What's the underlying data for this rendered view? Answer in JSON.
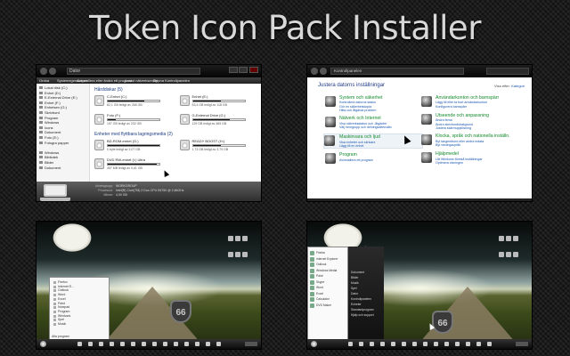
{
  "title": "Token Icon Pack Installer",
  "explorer": {
    "address": "Dator",
    "toolbar": [
      "Ordna",
      "Systemegenskaper",
      "Avinstallera eller ändra ett program",
      "Anslut nätverksenhet",
      "Öppna Kontrollpanelen"
    ],
    "sidebar": [
      "Lokal disk (C:)",
      "Enhet (D:)",
      "E-External Drive (E:)",
      "Enhet (F:)",
      "Enhetsen (G:)",
      "Skrivbord",
      "Program",
      "Windows",
      "Icons",
      "Dokument",
      "Foto (E:)",
      "Fotogra papper",
      "",
      "Windows",
      "Bibliotek",
      "Bilder",
      "Dokument"
    ],
    "group_hdd": "Hårddiskar (5)",
    "group_removable": "Enheter med flyttbara lagringsmedia (2)",
    "drives": [
      {
        "name": "C-Enhet (C:)",
        "free": "82,1 GB ledigt av 265 GB",
        "used": 0.7
      },
      {
        "name": "Enhet (E:)",
        "free": "53,4 GB ledigt av 118 GB",
        "used": 0.55
      },
      {
        "name": "Foto (F:)",
        "free": "197 GB ledigt av 232 GB",
        "used": 0.15
      },
      {
        "name": "G-External Drive (G:)",
        "free": "129 GB ledigt av 465 GB",
        "used": 0.72
      },
      {
        "name": "BD-ROM-enhet (G:)",
        "free": "0 byte ledigt av 2,07 GB",
        "used": 1.0
      },
      {
        "name": "READY BOOST (H:)",
        "free": "1,73 GB ledigt av 3,79 GB",
        "used": 0.55
      },
      {
        "name": "DVD RW-enhet (I:) Ultra",
        "free": "457 MB ledigt av 9,61 GB",
        "used": 0.95
      }
    ],
    "details": [
      {
        "label": "Arbetsgrupp:",
        "value": "WORKGROUP"
      },
      {
        "label": "Processor:",
        "value": "Intel(R) Core(TM) 2 Duo CPU E6750 @ 2,66GHz"
      },
      {
        "label": "Minne:",
        "value": "4,00 GB"
      }
    ]
  },
  "controlpanel": {
    "address": "Kontrollpanelen",
    "heading": "Justera datorns inställningar",
    "view_by": "Visa efter:",
    "view_value": "Kategori",
    "left_categories": [
      {
        "name": "System och säkerhet",
        "links": [
          "Kontrollera datorns status",
          "Gör en säkerhetskopia",
          "Hitta och åtgärda problem"
        ]
      },
      {
        "name": "Nätverk och Internet",
        "links": [
          "Visa nätverksstatus och -åtgärder",
          "Välj hemgrupp och delningsalternativ"
        ]
      },
      {
        "name": "Maskinvara och ljud",
        "links": [
          "Visa enheter och skrivare",
          "Lägg till en enhet"
        ]
      },
      {
        "name": "Program",
        "links": [
          "Avinstallera ett program"
        ]
      }
    ],
    "right_categories": [
      {
        "name": "Användarkonton och barnspärr",
        "links": [
          "Lägg till eller ta bort användarkonton",
          "Konfigurera barnspärr"
        ]
      },
      {
        "name": "Utseende och anpassning",
        "links": [
          "Ändra tema",
          "Ändra skrivbordsbakgrund",
          "Justera skärmupplösning"
        ]
      },
      {
        "name": "Klocka, språk och nationella inställn.",
        "links": [
          "Byt tangentbord eller andra indata",
          "Byt visningsspråk"
        ]
      },
      {
        "name": "Hjälpmedel",
        "links": [
          "Låt Windows föreslå inställningar",
          "Optimera visningen"
        ]
      }
    ]
  },
  "desktop1": {
    "shield": "66",
    "start_menu": [
      "Firefox",
      "Internet E...",
      "Outlook",
      "Word",
      "Excel",
      "Paint",
      "Notepad",
      "Program",
      "Windows",
      "Spel",
      "Musik"
    ],
    "footer": "Alla program"
  },
  "desktop2": {
    "shield": "66",
    "start_menu": [
      "Firefox",
      "Internet Explorer",
      "Outlook",
      "Windows Media",
      "Paint",
      "Skype",
      "Word",
      "Excel",
      "Calculator",
      "DVD Maker"
    ],
    "right_menu": [
      "Dokument",
      "Bilder",
      "Musik",
      "Spel",
      "Dator",
      "Kontrollpanelen",
      "Enheter",
      "Standardprogram",
      "Hjälp och support"
    ]
  }
}
